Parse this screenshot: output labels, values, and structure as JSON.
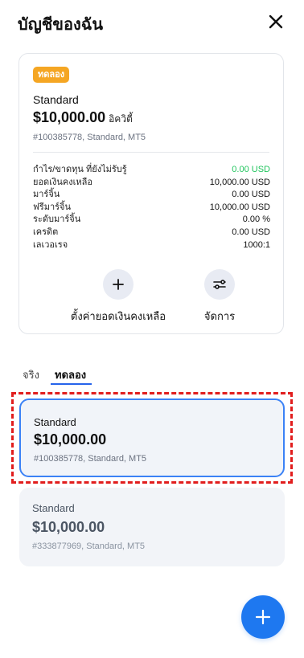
{
  "header": {
    "title": "บัญชีของฉัน",
    "close_icon": "close-icon"
  },
  "summary_card": {
    "badge": "ทดลอง",
    "account_name": "Standard",
    "balance": "$10,000.00",
    "currency_label": "อิควิตี้",
    "meta": "#100385778, Standard, MT5",
    "rows": [
      {
        "label": "กำไร/ขาดทุน ที่ยังไม่รับรู้",
        "value": "0.00 USD",
        "value_color": "#22c55e"
      },
      {
        "label": "ยอดเงินคงเหลือ",
        "value": "10,000.00 USD"
      },
      {
        "label": "มาร์จิ้น",
        "value": "0.00 USD"
      },
      {
        "label": "ฟรีมาร์จิ้น",
        "value": "10,000.00 USD"
      },
      {
        "label": "ระดับมาร์จิ้น",
        "value": "0.00 %"
      },
      {
        "label": "เครดิต",
        "value": "0.00 USD"
      },
      {
        "label": "เลเวอเรจ",
        "value": "1000:1"
      }
    ],
    "actions": [
      {
        "label": "ตั้งค่ายอดเงินคงเหลือ",
        "icon": "plus-icon"
      },
      {
        "label": "จัดการ",
        "icon": "sliders-icon"
      }
    ]
  },
  "tabs": [
    {
      "label": "จริง",
      "active": false
    },
    {
      "label": "ทดลอง",
      "active": true
    }
  ],
  "accounts": [
    {
      "name": "Standard",
      "balance": "$10,000.00",
      "meta": "#100385778, Standard, MT5",
      "selected": true
    },
    {
      "name": "Standard",
      "balance": "$10,000.00",
      "meta": "#333877969, Standard, MT5",
      "selected": false
    }
  ],
  "fab": {
    "icon": "plus-icon"
  },
  "colors": {
    "accent": "#1e78f0",
    "badge": "#f5a623",
    "positive": "#22c55e",
    "highlight": "#e11d1d"
  }
}
